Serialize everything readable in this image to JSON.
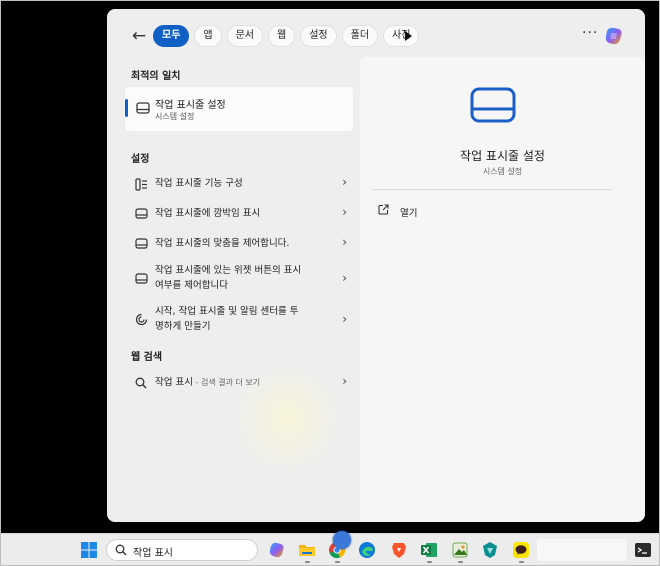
{
  "toolbar": {
    "tabs": [
      {
        "label": "모두",
        "active": true
      },
      {
        "label": "앱"
      },
      {
        "label": "문서"
      },
      {
        "label": "웹"
      },
      {
        "label": "설정"
      },
      {
        "label": "폴더"
      },
      {
        "label": "사진"
      }
    ],
    "more_label": "···"
  },
  "best_match": {
    "section_title": "최적의 일치",
    "title": "작업 표시줄 설정",
    "subtitle": "시스템 설정"
  },
  "settings": {
    "section_title": "설정",
    "items": [
      {
        "label": "작업 표시줄 기능 구성",
        "icon": "taskbar-features-icon"
      },
      {
        "label": "작업 표시줄에 깜박임 표시",
        "icon": "taskbar-icon"
      },
      {
        "label": "작업 표시줄의 맞춤을 제어합니다.",
        "icon": "taskbar-icon"
      },
      {
        "label_line1": "작업 표시줄에 있는 위젯 버튼의 표시",
        "label_line2": "여부를 제어합니다",
        "icon": "taskbar-icon"
      },
      {
        "label_line1": "시작, 작업 표시줄 및 알림 센터를 투",
        "label_line2": "명하게 만들기",
        "icon": "transparency-icon"
      }
    ]
  },
  "web": {
    "section_title": "웹 검색",
    "query": "작업 표시",
    "suffix": " - 검색 결과 더 보기"
  },
  "detail": {
    "title": "작업 표시줄 설정",
    "subtitle": "시스템 설정",
    "open_label": "열기"
  },
  "taskbar": {
    "search_text": "작업 표시"
  },
  "colors": {
    "accent": "#0f5fc4",
    "panel": "#eeeeee",
    "detail_bg": "#f6f6f6"
  }
}
